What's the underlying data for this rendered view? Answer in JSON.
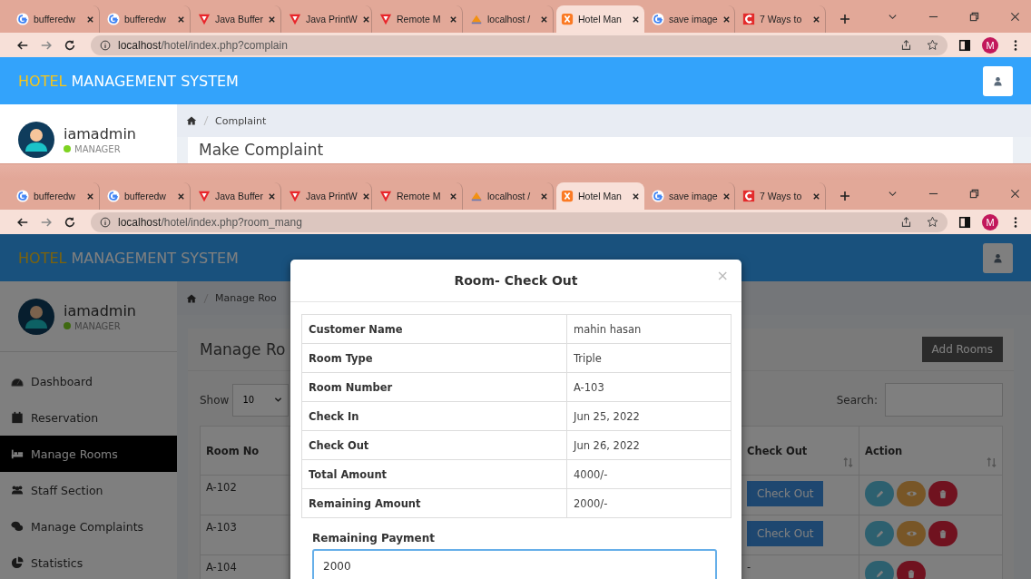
{
  "back_window": {
    "tabs": [
      {
        "title": "bufferedw",
        "kind": "google",
        "selected": false
      },
      {
        "title": "bufferedw",
        "kind": "google",
        "selected": false
      },
      {
        "title": "Java Buffer",
        "kind": "vivaldi",
        "selected": false
      },
      {
        "title": "Java PrintW",
        "kind": "vivaldi",
        "selected": false
      },
      {
        "title": "Remote M",
        "kind": "vivaldi",
        "selected": false
      },
      {
        "title": "localhost /",
        "kind": "pma",
        "selected": false
      },
      {
        "title": "Hotel Man",
        "kind": "xampp",
        "selected": true
      },
      {
        "title": "save image",
        "kind": "google",
        "selected": false
      },
      {
        "title": "7 Ways to",
        "kind": "c",
        "selected": false
      }
    ],
    "address": {
      "host": "localhost",
      "path": "/hotel/index.php?complain"
    },
    "profile_initial": "M",
    "brand": {
      "accent": "HOTEL",
      "rest": "MANAGEMENT SYSTEM"
    },
    "user": {
      "name": "iamadmin",
      "role": "MANAGER"
    },
    "breadcrumb": "Complaint",
    "card_title": "Make Complaint"
  },
  "front_window": {
    "tabs": [
      {
        "title": "bufferedw",
        "kind": "google",
        "selected": false
      },
      {
        "title": "bufferedw",
        "kind": "google",
        "selected": false
      },
      {
        "title": "Java Buffer",
        "kind": "vivaldi",
        "selected": false
      },
      {
        "title": "Java PrintW",
        "kind": "vivaldi",
        "selected": false
      },
      {
        "title": "Remote M",
        "kind": "vivaldi",
        "selected": false
      },
      {
        "title": "localhost /",
        "kind": "pma",
        "selected": false
      },
      {
        "title": "Hotel Man",
        "kind": "xampp",
        "selected": true
      },
      {
        "title": "save image",
        "kind": "google",
        "selected": false
      },
      {
        "title": "7 Ways to",
        "kind": "c",
        "selected": false
      }
    ],
    "address": {
      "host": "localhost",
      "path": "/hotel/index.php?room_mang"
    },
    "profile_initial": "M",
    "brand": {
      "accent": "HOTEL",
      "rest": "MANAGEMENT SYSTEM"
    },
    "user": {
      "name": "iamadmin",
      "role": "MANAGER"
    },
    "sidebar": [
      {
        "label": "Dashboard",
        "kind": "dashboard",
        "selected": false
      },
      {
        "label": "Reservation",
        "kind": "calendar",
        "selected": false
      },
      {
        "label": "Manage Rooms",
        "kind": "bed",
        "selected": true
      },
      {
        "label": "Staff Section",
        "kind": "users",
        "selected": false
      },
      {
        "label": "Manage Complaints",
        "kind": "comments",
        "selected": false
      },
      {
        "label": "Statistics",
        "kind": "pie",
        "selected": false
      }
    ],
    "breadcrumb": "Manage Roo",
    "card_title": "Manage Ro",
    "add_button": "Add Rooms",
    "length_label": "Show",
    "length_value": "10",
    "search_label": "Search:",
    "table": {
      "columns": [
        {
          "label": "Room No",
          "sort_icon": false
        },
        {
          "label": "Check Out",
          "sort_icon": true
        },
        {
          "label": "Action",
          "sort_icon": true
        }
      ],
      "rows": [
        {
          "room": "A-102",
          "checkout": {
            "kind": "button",
            "text": "Check Out"
          },
          "actions": [
            {
              "kind": "edit"
            },
            {
              "kind": "view"
            },
            {
              "kind": "delete"
            }
          ]
        },
        {
          "room": "A-103",
          "checkout": {
            "kind": "button",
            "text": "Check Out"
          },
          "actions": [
            {
              "kind": "edit"
            },
            {
              "kind": "view"
            },
            {
              "kind": "delete"
            }
          ]
        },
        {
          "room": "A-104",
          "checkout": {
            "kind": "text",
            "text": "-"
          },
          "actions": [
            {
              "kind": "edit"
            },
            {
              "kind": "delete"
            }
          ]
        }
      ]
    },
    "modal": {
      "title": "Room- Check Out",
      "close": "×",
      "details": [
        {
          "label": "Customer Name",
          "value": "mahin hasan"
        },
        {
          "label": "Room Type",
          "value": "Triple"
        },
        {
          "label": "Room Number",
          "value": "A-103"
        },
        {
          "label": "Check In",
          "value": "Jun 25, 2022"
        },
        {
          "label": "Check Out",
          "value": "Jun 26, 2022"
        },
        {
          "label": "Total Amount",
          "value": "4000/-"
        },
        {
          "label": "Remaining Amount",
          "value": "2000/-"
        }
      ],
      "field_label": "Remaining Payment",
      "field_value": "2000"
    }
  }
}
